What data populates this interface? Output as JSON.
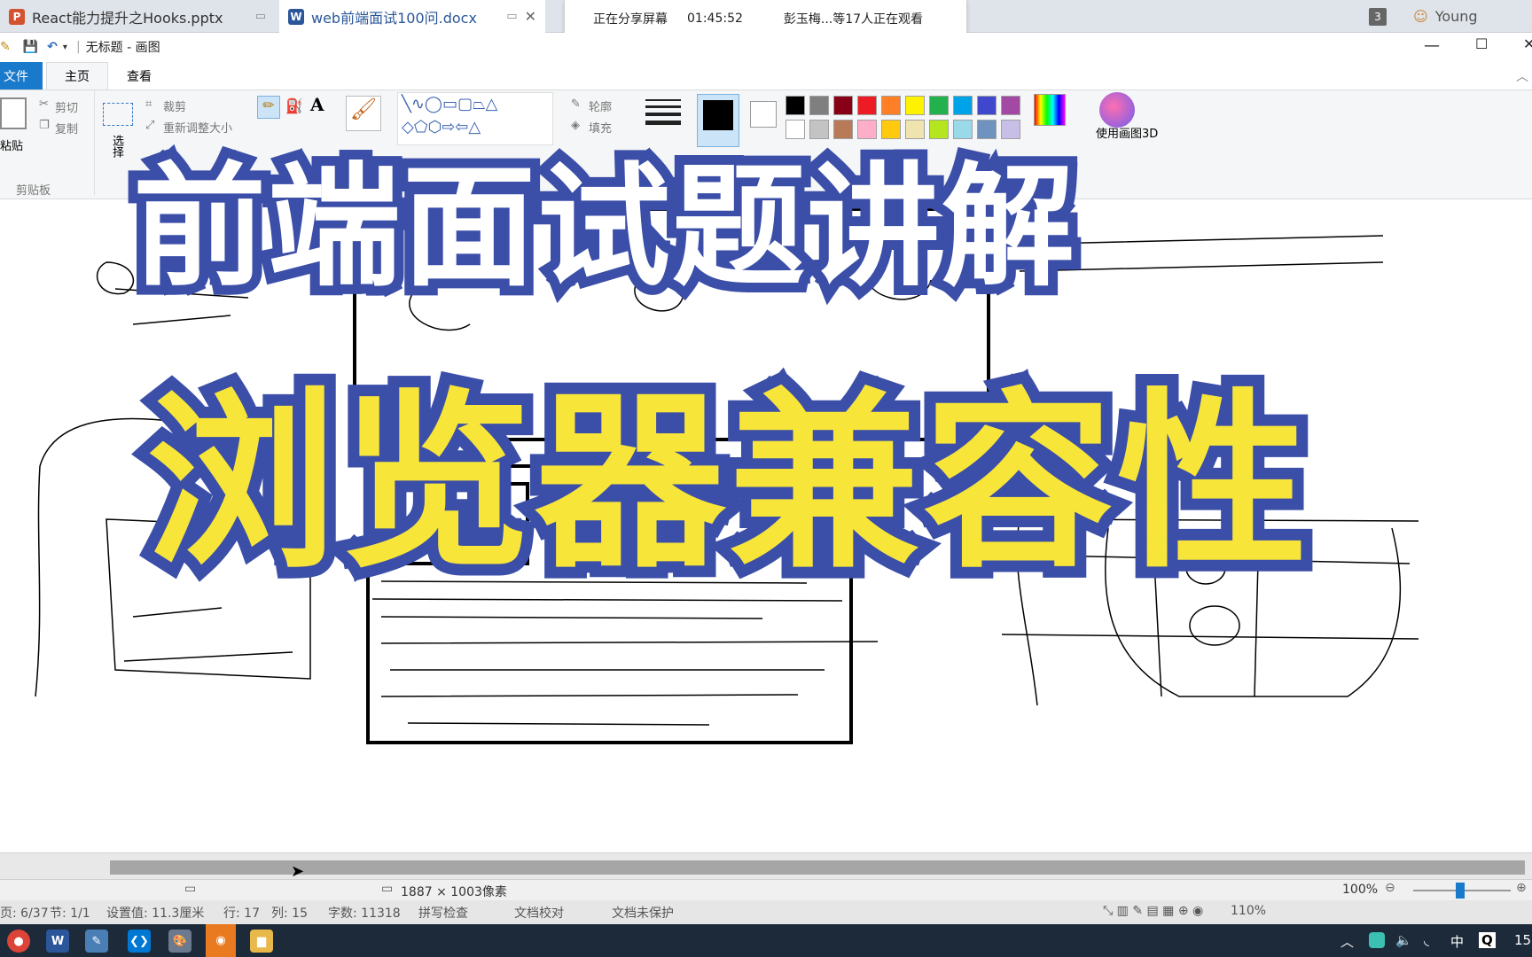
{
  "doc_tabs": [
    {
      "label": "React能力提升之Hooks.pptx",
      "icon": "ppt-icon",
      "color": "#d35230"
    },
    {
      "label": "web前端面试100问.docx",
      "icon": "word-icon",
      "color": "#2b579a"
    }
  ],
  "window_count": "3",
  "user_name": "Young",
  "share": {
    "status": "正在分享屏幕",
    "time": "01:45:52",
    "viewers": "彭玉梅...等17人正在观看"
  },
  "app_title": "无标题 - 画图",
  "ribbon_tabs": {
    "file": "文件",
    "home": "主页",
    "view": "查看"
  },
  "ribbon": {
    "paste": "粘贴",
    "cut": "剪切",
    "copy": "复制",
    "clipboard_group": "剪贴板",
    "select": "选择",
    "crop": "裁剪",
    "resize": "重新调整大小",
    "outline": "轮廓",
    "fill": "填充",
    "paint3d": "使用画图3D"
  },
  "palette": [
    "#000000",
    "#7f7f7f",
    "#880015",
    "#ed1c24",
    "#ff7f27",
    "#fff200",
    "#22b14c",
    "#00a2e8",
    "#3f48cc",
    "#a349a4",
    "#ffffff",
    "#c3c3c3",
    "#b97a57",
    "#ffaec9",
    "#ffc90e",
    "#efe4b0",
    "#b5e61d",
    "#99d9ea",
    "#7092be",
    "#c8bfe7"
  ],
  "overlay": {
    "line1": "前端面试题讲解",
    "line2": "浏览器兼容性"
  },
  "status": {
    "dimensions": "1887 × 1003像素",
    "zoom": "100%"
  },
  "word_status": {
    "page": "页: 6/37",
    "section": "节: 1/1",
    "setting": "设置值: 11.3厘米",
    "row": "行: 17",
    "col": "列: 15",
    "words": "字数: 11318",
    "spell": "拼写检查",
    "proof": "文档校对",
    "protect": "文档未保护",
    "zoom": "110%"
  },
  "tray": {
    "ime": "中",
    "time": "15"
  }
}
